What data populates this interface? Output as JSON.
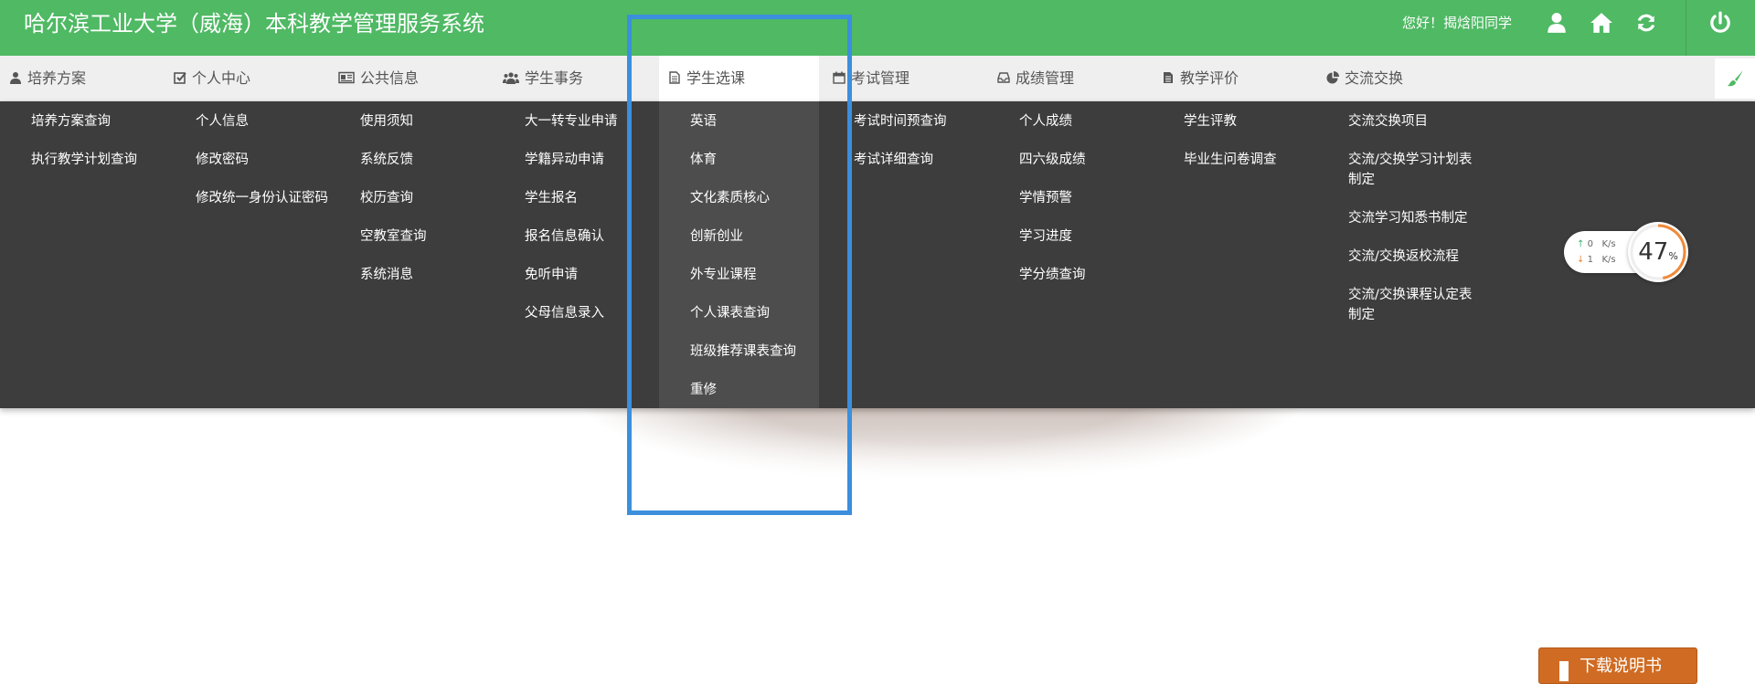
{
  "header": {
    "title": "哈尔滨工业大学（威海）本科教学管理服务系统",
    "greeting": "您好！揭焓阳同学",
    "icons": [
      "user-icon",
      "home-icon",
      "refresh-icon",
      "power-icon"
    ],
    "background_color": "#4fb964"
  },
  "nav": {
    "items": [
      {
        "label": "培养方案",
        "icon": "user-icon"
      },
      {
        "label": "个人中心",
        "icon": "check-square-icon"
      },
      {
        "label": "公共信息",
        "icon": "newspaper-icon"
      },
      {
        "label": "学生事务",
        "icon": "users-icon"
      },
      {
        "label": "学生选课",
        "icon": "file-icon",
        "active": true
      },
      {
        "label": "考试管理",
        "icon": "calendar-icon"
      },
      {
        "label": "成绩管理",
        "icon": "inbox-icon"
      },
      {
        "label": "教学评价",
        "icon": "document-icon"
      },
      {
        "label": "交流交换",
        "icon": "pie-chart-icon"
      }
    ],
    "right_icon": "paintbrush-icon"
  },
  "menu": {
    "columns": [
      [
        "培养方案查询",
        "执行教学计划查询"
      ],
      [
        "个人信息",
        "修改密码",
        "修改统一身份认证密码"
      ],
      [
        "使用须知",
        "系统反馈",
        "校历查询",
        "空教室查询",
        "系统消息"
      ],
      [
        "大一转专业申请",
        "学籍异动申请",
        "学生报名",
        "报名信息确认",
        "免听申请",
        "父母信息录入"
      ],
      [
        "英语",
        "体育",
        "文化素质核心",
        "创新创业",
        "外专业课程",
        "个人课表查询",
        "班级推荐课表查询",
        "重修"
      ],
      [
        "考试时间预查询",
        "考试详细查询"
      ],
      [
        "个人成绩",
        "四六级成绩",
        "学情预警",
        "学习进度",
        "学分绩查询"
      ],
      [
        "学生评教",
        "毕业生问卷调查"
      ],
      [
        "交流交换项目",
        "交流/交换学习计划表制定",
        "交流学习知悉书制定",
        "交流/交换返校流程",
        "交流/交换课程认定表制定"
      ]
    ],
    "background_color": "#3d3d3d",
    "highlight_color": "#4d4d4d"
  },
  "speed_widget": {
    "upload_value": "0",
    "upload_unit": "K/s",
    "download_value": "1",
    "download_unit": "K/s",
    "percent": 47,
    "percent_label": "47",
    "percent_suffix": "%"
  },
  "download_button": {
    "label": "下载说明书"
  },
  "selection_color": "#3b8fdd"
}
